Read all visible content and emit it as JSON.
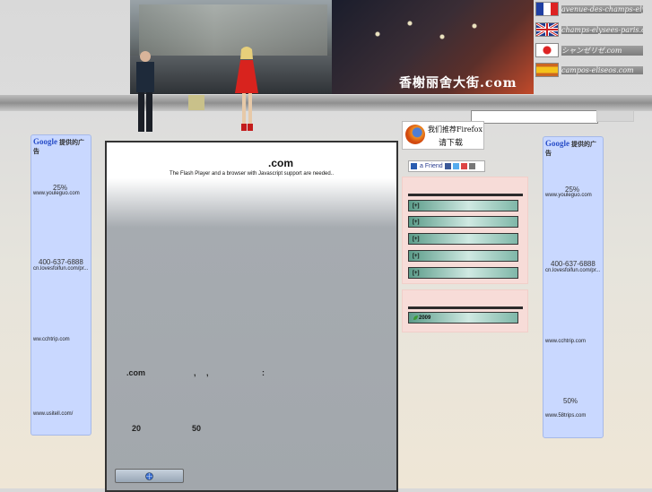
{
  "banner": {
    "title": "香榭丽舍大街.com",
    "languages": [
      {
        "text": "avenue-des-champs-elysees.com",
        "flag": "fr"
      },
      {
        "text": "champs-elysees-paris.org",
        "flag": "gb"
      },
      {
        "text": "シャンゼリゼ.com",
        "flag": "jp"
      },
      {
        "text": "campos-eliseos.com",
        "flag": "es"
      }
    ]
  },
  "search": {
    "placeholder": "",
    "button_label": ""
  },
  "left_ads": {
    "header": "提供的广告",
    "brand": "Google",
    "percent1": "25%",
    "url1": "www.youleguo.com",
    "phone": "400-637-6888",
    "url2": "cn.lovesfoifun.com/pr...",
    "url3": "ww.cchtrip.com",
    "url4": "www.usitell.com/"
  },
  "right_ads": {
    "header": "提供的广告",
    "brand": "Google",
    "percent1": "25%",
    "url1": "www.youleguo.com",
    "phone": "400-637-6888",
    "url2": "cn.lovesfoifun.com/pr...",
    "url3": "www.cchtrip.com",
    "percent2": "50%",
    "url4": "www.58trips.com"
  },
  "main": {
    "title": ".com",
    "flash_message": "The Flash Player and a browser with Javascript support are needed..",
    "line1_a": ".com",
    "line1_b": ",",
    "line1_c": ",",
    "line1_d": ":",
    "num1": "20",
    "num2": "50"
  },
  "firefox": {
    "line1": "我们推荐Firefox",
    "line2": "请下载"
  },
  "share": {
    "label": "a Friend"
  },
  "menu": {
    "items": [
      "[+]",
      "[+]",
      "[+]",
      "[+]",
      "[+]"
    ],
    "item2009": "2009"
  }
}
